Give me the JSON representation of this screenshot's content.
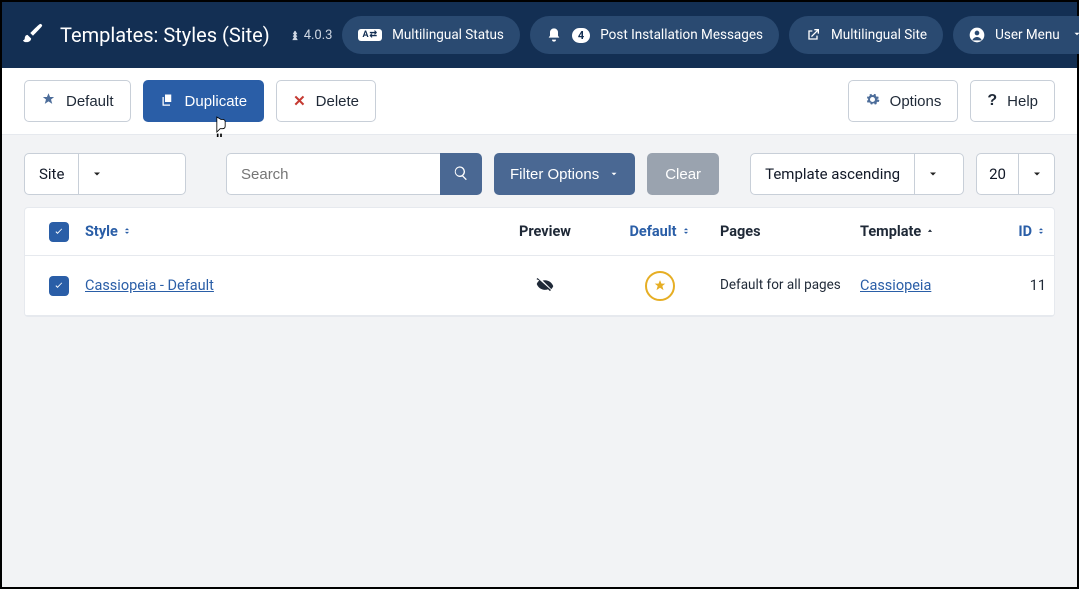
{
  "nav": {
    "title": "Templates: Styles (Site)",
    "version": "4.0.3",
    "multilingual_status": "Multilingual Status",
    "post_install": "Post Installation Messages",
    "post_install_count": "4",
    "multilingual_site": "Multilingual Site",
    "user_menu": "User Menu"
  },
  "toolbar": {
    "default_label": "Default",
    "duplicate_label": "Duplicate",
    "delete_label": "Delete",
    "options_label": "Options",
    "help_label": "Help"
  },
  "filters": {
    "client_value": "Site",
    "search_placeholder": "Search",
    "filter_options_label": "Filter Options",
    "clear_label": "Clear",
    "order_value": "Template ascending",
    "limit_value": "20"
  },
  "table": {
    "headers": {
      "style": "Style",
      "preview": "Preview",
      "default": "Default",
      "pages": "Pages",
      "template": "Template",
      "id": "ID"
    },
    "rows": [
      {
        "checked": true,
        "style": "Cassiopeia - Default",
        "template": "Cassiopeia",
        "pages": "Default for all pages",
        "id": "11"
      }
    ]
  }
}
